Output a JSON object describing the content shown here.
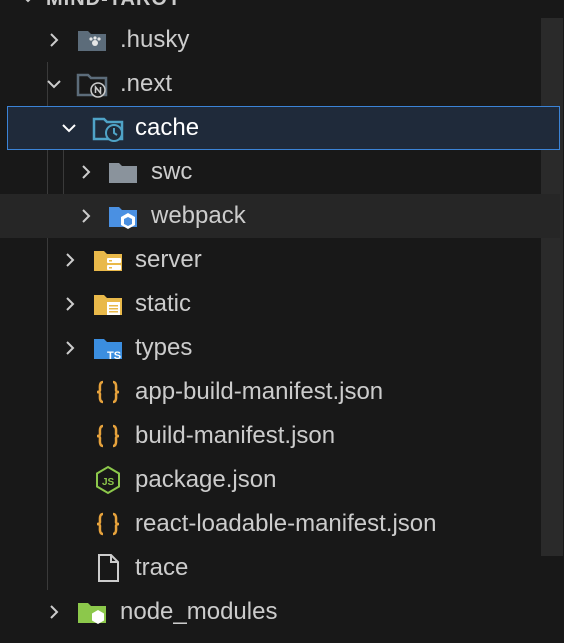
{
  "explorer": {
    "section_title": "MIND-TAROT",
    "items": [
      {
        "label": ".husky",
        "icon": "husky-folder-icon",
        "expanded": false
      },
      {
        "label": ".next",
        "icon": "next-folder-icon",
        "expanded": true
      },
      {
        "label": "cache",
        "icon": "cache-folder-icon",
        "expanded": true,
        "selected": true
      },
      {
        "label": "swc",
        "icon": "folder-icon",
        "expanded": false
      },
      {
        "label": "webpack",
        "icon": "webpack-folder-icon",
        "expanded": false
      },
      {
        "label": "server",
        "icon": "server-folder-icon",
        "expanded": false
      },
      {
        "label": "static",
        "icon": "static-folder-icon",
        "expanded": false
      },
      {
        "label": "types",
        "icon": "typescript-folder-icon",
        "expanded": false
      },
      {
        "label": "app-build-manifest.json",
        "icon": "json-file-icon"
      },
      {
        "label": "build-manifest.json",
        "icon": "json-file-icon"
      },
      {
        "label": "package.json",
        "icon": "nodejs-file-icon"
      },
      {
        "label": "react-loadable-manifest.json",
        "icon": "json-file-icon"
      },
      {
        "label": "trace",
        "icon": "file-icon"
      },
      {
        "label": "node_modules",
        "icon": "node-modules-folder-icon",
        "expanded": false
      }
    ]
  },
  "colors": {
    "background": "#181818",
    "selection_border": "#3b83d6",
    "folder_yellow": "#e9b94a",
    "folder_blue": "#4a90e2",
    "json_orange": "#e6a23c",
    "node_green": "#8cc84b"
  }
}
